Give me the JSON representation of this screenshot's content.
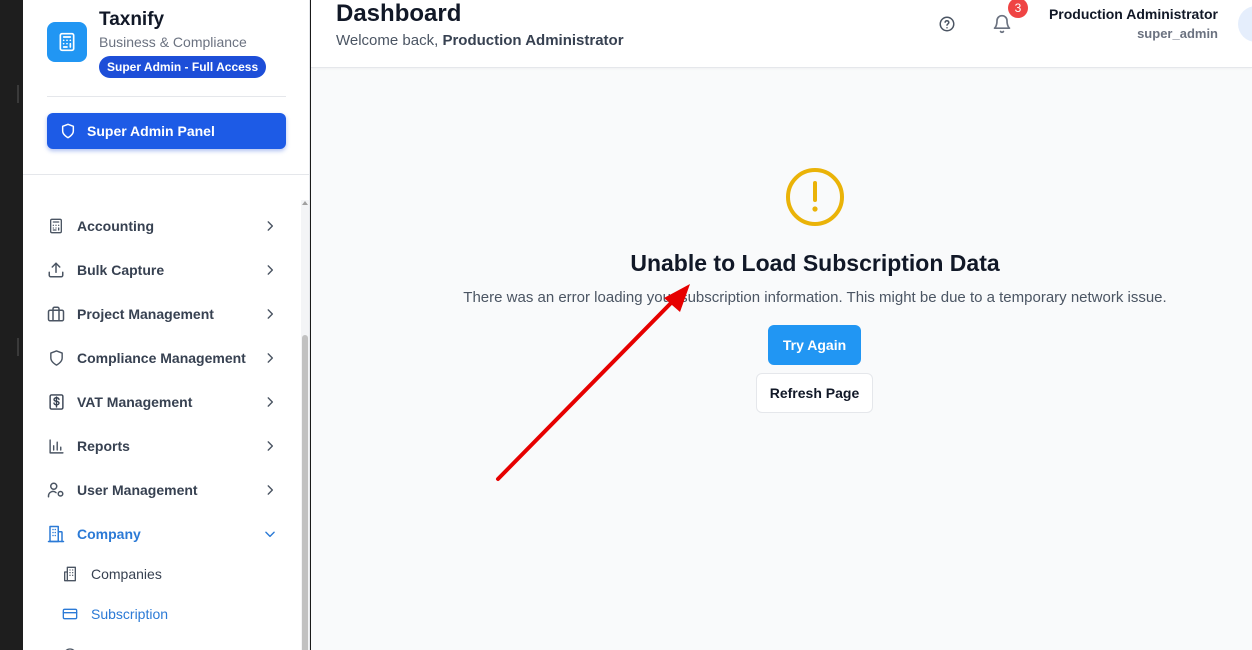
{
  "sidebar": {
    "brand": {
      "name": "Taxnify",
      "subtitle": "Business & Compliance",
      "role_badge": "Super Admin - Full Access",
      "logo_icon": "calculator-icon"
    },
    "admin_panel_label": "Super Admin Panel",
    "items": [
      {
        "label": "Accounting",
        "icon": "calculator-icon"
      },
      {
        "label": "Bulk Capture",
        "icon": "upload-icon"
      },
      {
        "label": "Project Management",
        "icon": "briefcase-icon"
      },
      {
        "label": "Compliance Management",
        "icon": "shield-icon"
      },
      {
        "label": "VAT Management",
        "icon": "dollar-square-icon"
      },
      {
        "label": "Reports",
        "icon": "bar-chart-icon"
      },
      {
        "label": "User Management",
        "icon": "user-cog-icon"
      },
      {
        "label": "Company",
        "icon": "building-icon",
        "expanded": true
      }
    ],
    "sub_items": [
      {
        "label": "Companies",
        "icon": "buildings-icon"
      },
      {
        "label": "Subscription",
        "icon": "credit-card-icon",
        "active": true
      }
    ]
  },
  "header": {
    "title": "Dashboard",
    "welcome_prefix": "Welcome back,",
    "welcome_name": "Production Administrator",
    "notification_count": "3",
    "user_name": "Production Administrator",
    "user_role": "super_admin"
  },
  "error": {
    "title": "Unable to Load Subscription Data",
    "message": "There was an error loading your subscription information. This might be due to a temporary network issue.",
    "try_again_label": "Try Again",
    "refresh_label": "Refresh Page"
  },
  "colors": {
    "primary": "#2196f3",
    "admin_button": "#1d5be6",
    "active_nav": "#2b7ad6",
    "warning": "#eab308",
    "badge": "#ef4444",
    "annotation_arrow": "#e60000"
  }
}
